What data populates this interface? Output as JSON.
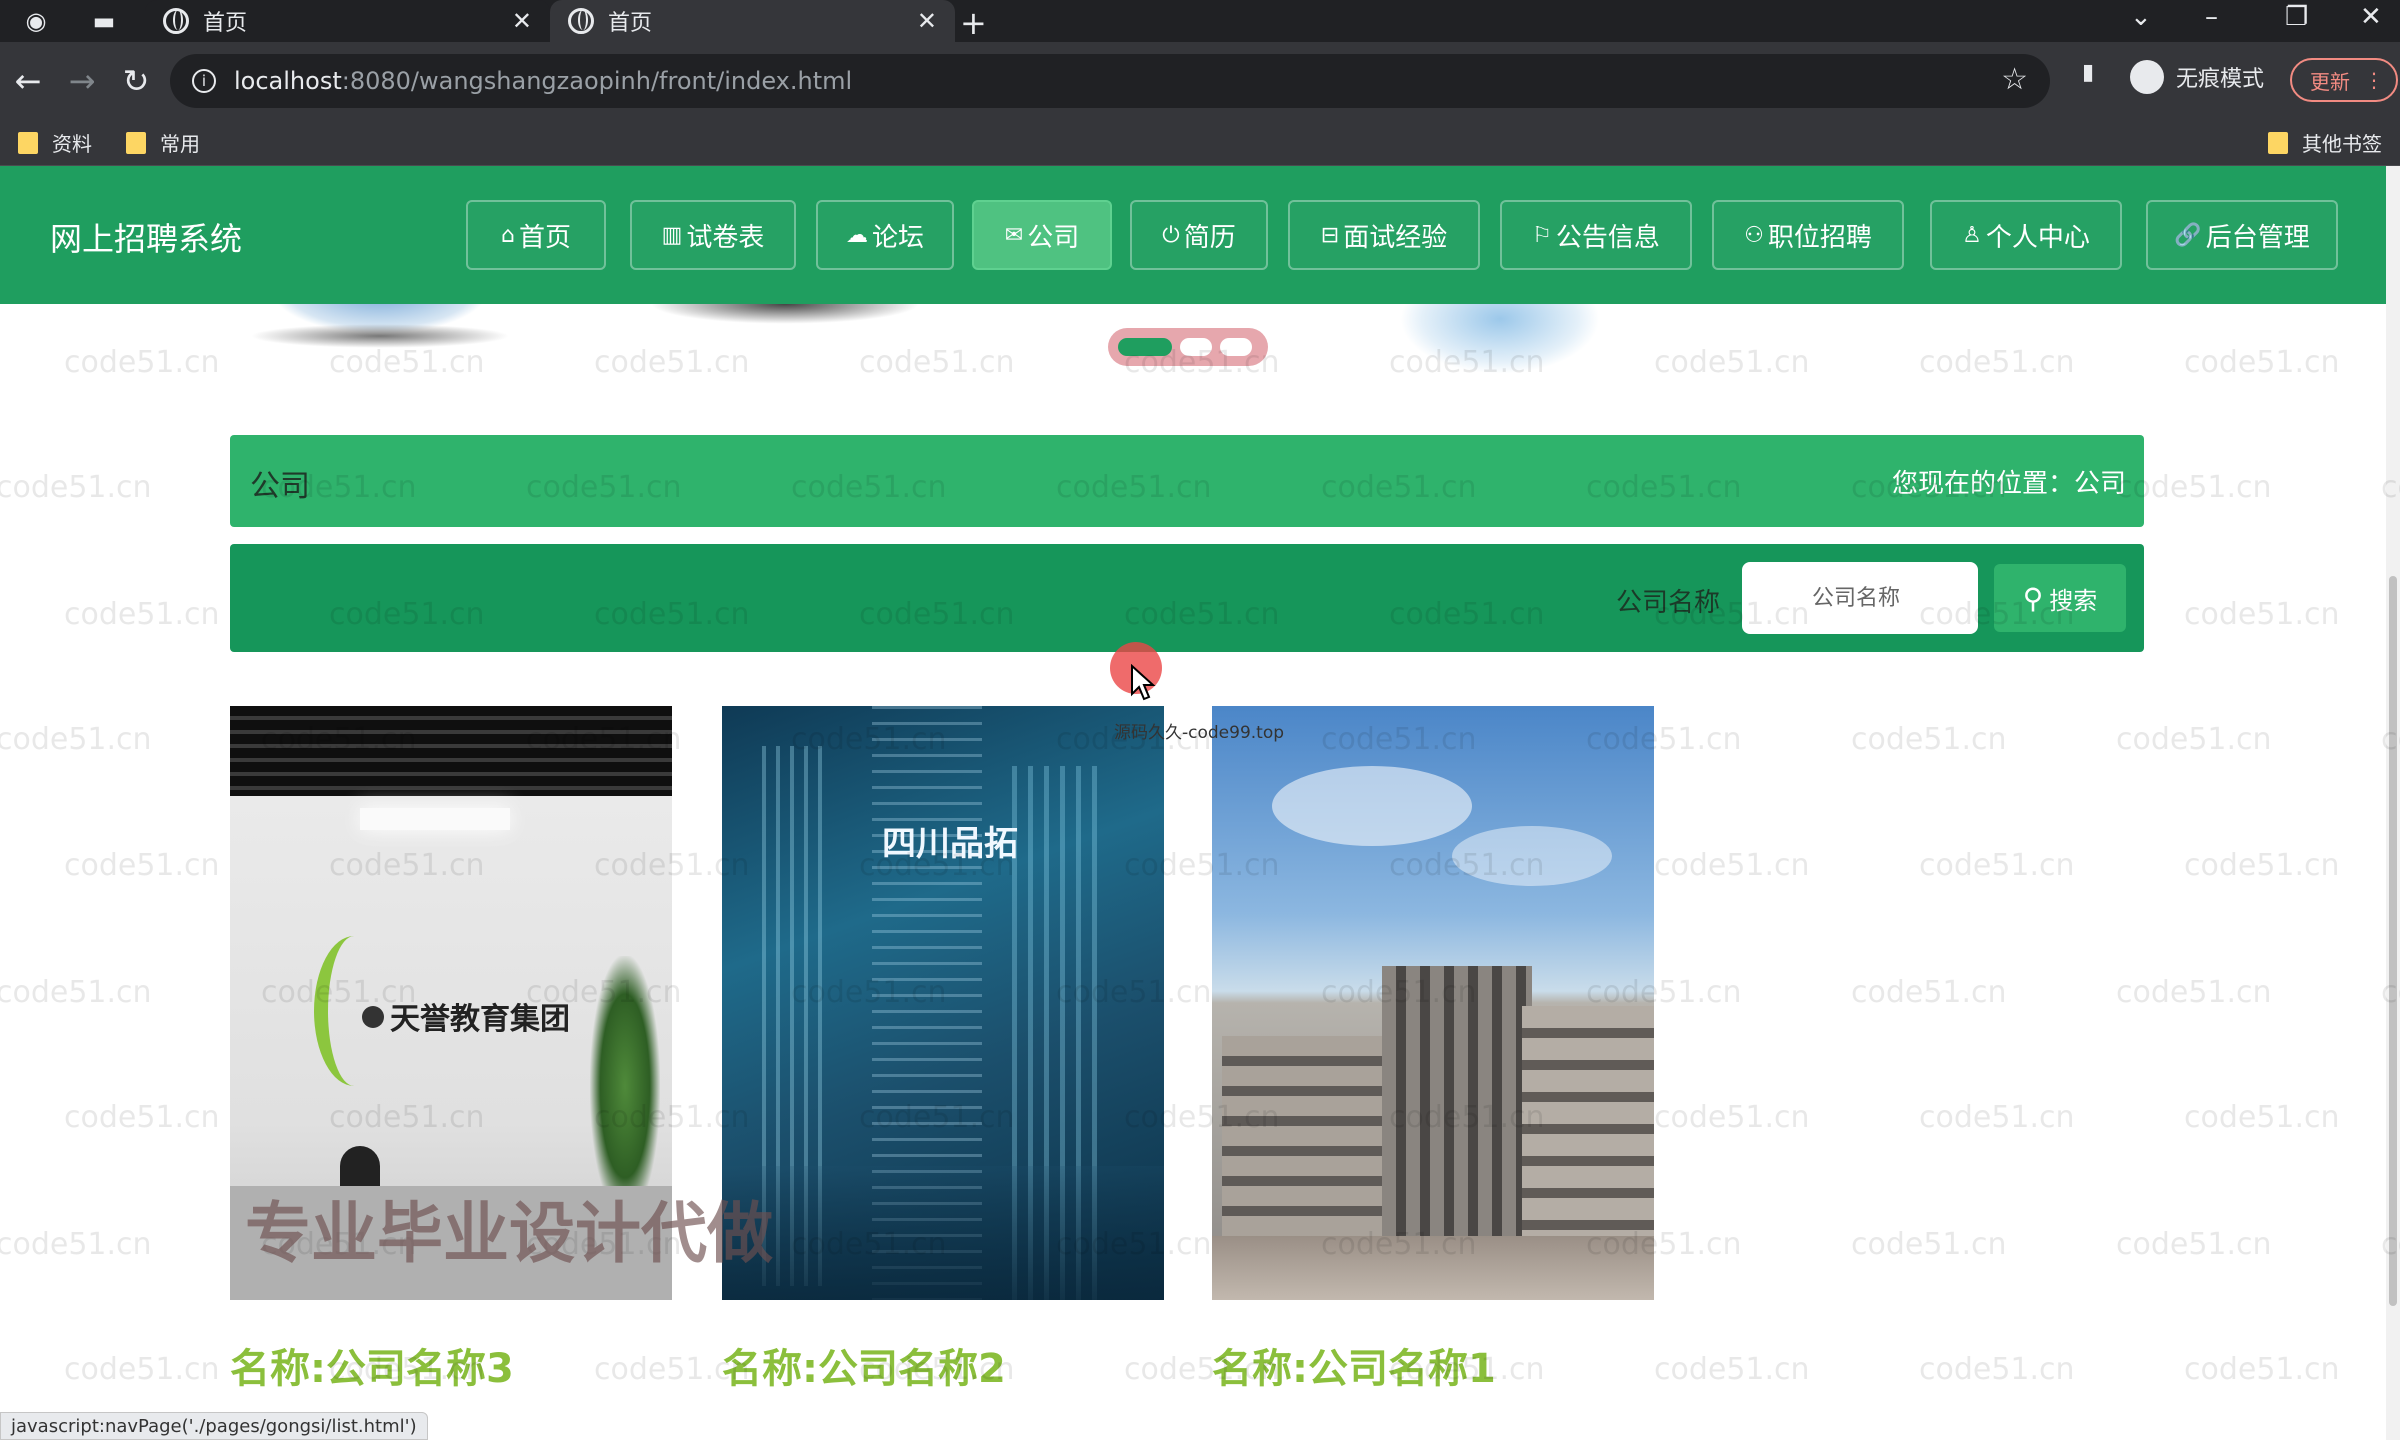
{
  "browser": {
    "tabs": [
      {
        "label": "首页",
        "state": "inactive"
      },
      {
        "label": "首页",
        "state": "active"
      }
    ],
    "new_tab": "+",
    "address": {
      "host": "localhost",
      "rest": ":8080/wangshangzaopinh/front/index.html"
    },
    "incognito_label": "无痕模式",
    "update_label": "更新",
    "bookmarks": [
      "资料",
      "常用"
    ],
    "other_bookmarks": "其他书签"
  },
  "site": {
    "logo": "网上招聘系统",
    "nav": [
      {
        "label": "首页",
        "icon": "⌂",
        "active": false
      },
      {
        "label": "试卷表",
        "icon": "▥",
        "active": false
      },
      {
        "label": "论坛",
        "icon": "☁",
        "active": false
      },
      {
        "label": "公司",
        "icon": "✉",
        "active": true
      },
      {
        "label": "简历",
        "icon": "⏻",
        "active": false
      },
      {
        "label": "面试经验",
        "icon": "⊟",
        "active": false
      },
      {
        "label": "公告信息",
        "icon": "⚐",
        "active": false
      },
      {
        "label": "职位招聘",
        "icon": "⚇",
        "active": false
      },
      {
        "label": "个人中心",
        "icon": "♙",
        "active": false
      },
      {
        "label": "后台管理",
        "icon": "🔗",
        "active": false
      }
    ],
    "section_title": "公司",
    "location_text": "您现在的位置：公司",
    "search": {
      "label": "公司名称",
      "placeholder": "公司名称",
      "button": "搜索"
    },
    "companies": [
      {
        "name": "名称:公司名称3",
        "logo_text": "天誉教育集团"
      },
      {
        "name": "名称:公司名称2",
        "logo_text": "四川品拓"
      },
      {
        "name": "名称:公司名称1"
      }
    ]
  },
  "overlays": {
    "watermark": "code51.cn",
    "big_text": "专业毕业设计代做",
    "cursor_caption": "源码久久-code99.top",
    "status_url": "javascript:navPage('./pages/gongsi/list.html')"
  },
  "colors": {
    "nav_green": "#1f9e5f",
    "title_green": "#2fb36c",
    "search_green": "#16965a",
    "name_green": "#8bbf3c"
  }
}
